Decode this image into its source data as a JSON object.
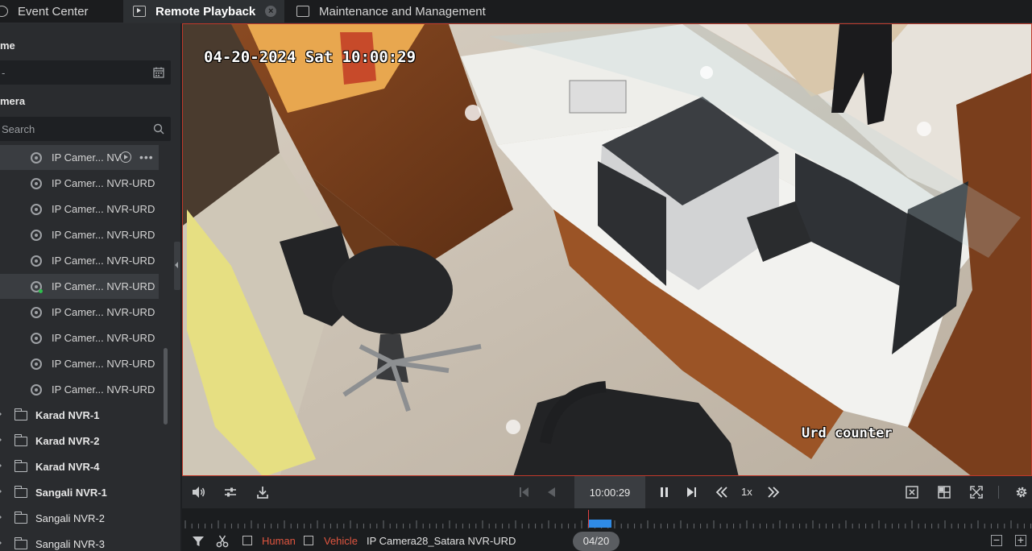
{
  "tabs": [
    {
      "label": "Event Center",
      "icon": "event-center-icon",
      "active": false
    },
    {
      "label": "Remote Playback",
      "icon": "playback-icon",
      "active": true
    },
    {
      "label": "Maintenance and Management",
      "icon": "maintenance-icon",
      "active": false
    }
  ],
  "sidebar": {
    "time_title": "me",
    "time_value": "-",
    "camera_title": "mera",
    "search_placeholder": "Search",
    "cameras": [
      {
        "label": "IP Camer... NV",
        "selected": true,
        "live": false
      },
      {
        "label": "IP Camer... NVR-URD",
        "selected": false,
        "live": false
      },
      {
        "label": "IP Camer... NVR-URD",
        "selected": false,
        "live": false
      },
      {
        "label": "IP Camer... NVR-URD",
        "selected": false,
        "live": false
      },
      {
        "label": "IP Camer... NVR-URD",
        "selected": false,
        "live": false
      },
      {
        "label": "IP Camer... NVR-URD",
        "selected": false,
        "live": false
      },
      {
        "label": "IP Camer... NVR-URD",
        "selected": true,
        "live": true
      },
      {
        "label": "IP Camer... NVR-URD",
        "selected": false,
        "live": false
      },
      {
        "label": "IP Camer... NVR-URD",
        "selected": false,
        "live": false
      },
      {
        "label": "IP Camer... NVR-URD",
        "selected": false,
        "live": false
      },
      {
        "label": "IP Camer... NVR-URD",
        "selected": false,
        "live": false
      }
    ],
    "folders": [
      {
        "label": "Karad NVR-1",
        "bold": true
      },
      {
        "label": "Karad NVR-2",
        "bold": true
      },
      {
        "label": "Karad NVR-4",
        "bold": true
      },
      {
        "label": "Sangali NVR-1",
        "bold": true
      },
      {
        "label": "Sangali NVR-2",
        "bold": false
      },
      {
        "label": "Sangali NVR-3",
        "bold": false
      }
    ]
  },
  "video": {
    "osd_timestamp": "04-20-2024 Sat 10:00:29",
    "osd_label": "Urd counter"
  },
  "controls": {
    "current_time": "10:00:29",
    "speed": "1x"
  },
  "timeline": {
    "date": "04/20",
    "filter_human": "Human",
    "filter_vehicle": "Vehicle",
    "camera_name": "IP Camera28_Satara NVR-URD"
  },
  "colors": {
    "accent_blue": "#2f8be6",
    "active_border": "#c0392b",
    "live_dot": "#2fbf4e",
    "filter_red": "#e0553f"
  }
}
